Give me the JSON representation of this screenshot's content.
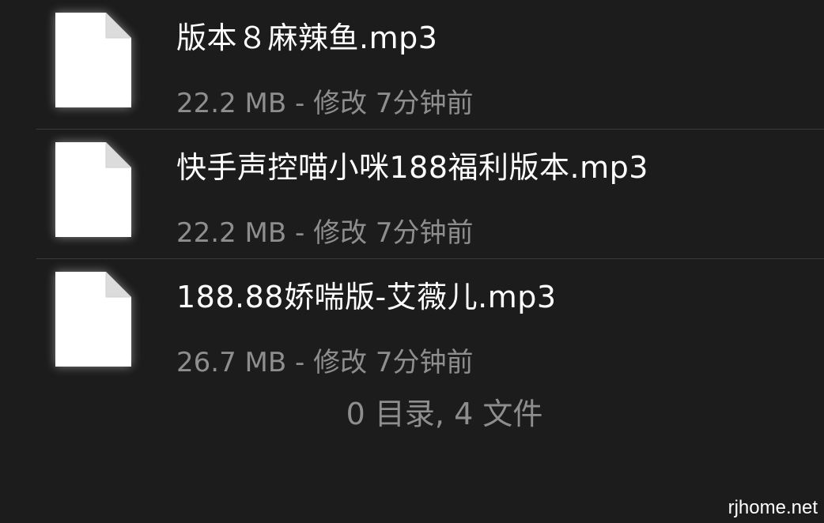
{
  "files": [
    {
      "name": "版本８麻辣鱼.mp3",
      "size": "22.2 MB",
      "separator": "-",
      "modified": "修改 7分钟前",
      "icon": "document-icon"
    },
    {
      "name": "快手声控喵小咪188福利版本.mp3",
      "size": "22.2 MB",
      "separator": "-",
      "modified": "修改 7分钟前",
      "icon": "document-icon"
    },
    {
      "name": "188.88娇喘版-艾薇儿.mp3",
      "size": "26.7 MB",
      "separator": "-",
      "modified": "修改 7分钟前",
      "icon": "document-icon"
    }
  ],
  "summary": "0 目录, 4 文件",
  "watermark": "rjhome.net",
  "colors": {
    "background": "#1c1c1c",
    "primary_text": "#ffffff",
    "secondary_text": "#8e8e8e",
    "divider": "#3a3a3a"
  }
}
